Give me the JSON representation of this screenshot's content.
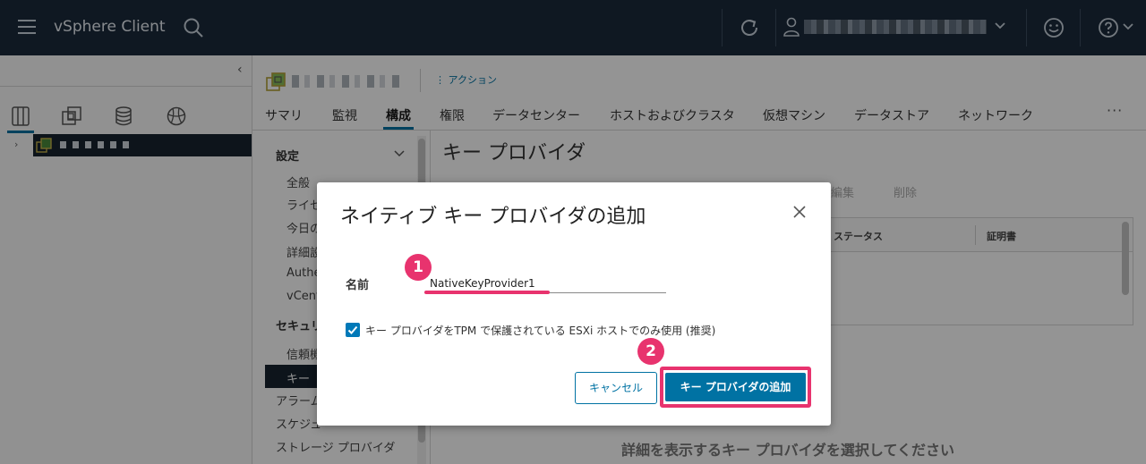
{
  "header": {
    "app_title": "vSphere Client"
  },
  "sidebar": {
    "tabs": [
      "hosts-and-clusters-icon",
      "vms-and-templates-icon",
      "storage-icon",
      "networking-icon"
    ],
    "active_tab": 0
  },
  "object": {
    "actions_label": "アクション"
  },
  "tabs": [
    {
      "label": "サマリ"
    },
    {
      "label": "監視"
    },
    {
      "label": "構成",
      "active": true
    },
    {
      "label": "権限"
    },
    {
      "label": "データセンター"
    },
    {
      "label": "ホストおよびクラスタ"
    },
    {
      "label": "仮想マシン"
    },
    {
      "label": "データストア"
    },
    {
      "label": "ネットワーク"
    }
  ],
  "tab_more": "···",
  "config_nav": {
    "group1": "設定",
    "items1": [
      "全般",
      "ライセ",
      "今日の",
      "詳細設",
      "Authe",
      "vCent"
    ],
    "group2": "セキュリ",
    "items2": [
      "信頼機",
      "キー"
    ],
    "items3": [
      "アラーム",
      "スケジュ",
      "ストレージ プロバイダ"
    ]
  },
  "main": {
    "title": "キー プロバイダ",
    "toolbar_edit": "編集",
    "toolbar_delete": "削除",
    "col_status": "ステータス",
    "col_cert": "証明書",
    "detail_prompt": "詳細を表示するキー プロバイダを選択してください"
  },
  "dialog": {
    "title": "ネイティブ キー プロバイダの追加",
    "name_label": "名前",
    "name_value": "NativeKeyProvider1",
    "checkbox_label": "キー プロバイダをTPM で保護されている ESXi ホストでのみ使用 (推奨)",
    "checkbox_checked": true,
    "cancel_label": "キャンセル",
    "add_label": "キー プロバイダの追加",
    "badge1": "1",
    "badge2": "2"
  },
  "colors": {
    "header_bg": "#1b2a3b",
    "accent": "#0072a3",
    "annotation": "#e8336e"
  }
}
